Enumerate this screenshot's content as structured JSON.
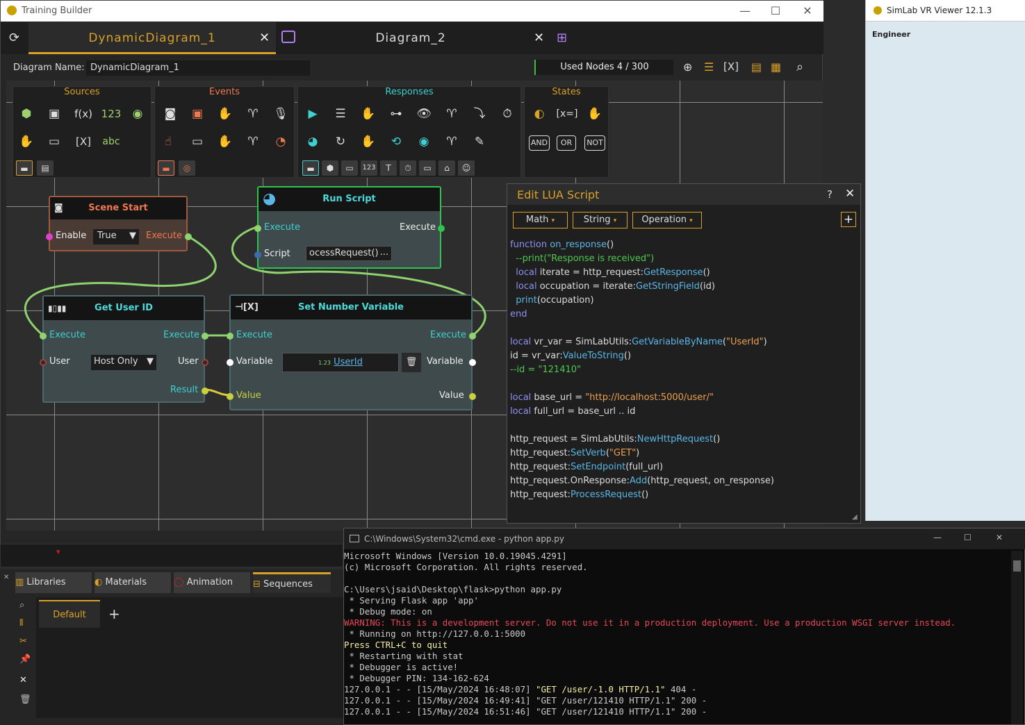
{
  "training_builder": {
    "title": "Training Builder",
    "tabs": [
      {
        "label": "DynamicDiagram_1"
      },
      {
        "label": "Diagram_2"
      }
    ],
    "diagram_name_label": "Diagram Name:",
    "diagram_name": "DynamicDiagram_1",
    "used_nodes": "Used Nodes 4 / 300"
  },
  "palette": {
    "sources": "Sources",
    "events": "Events",
    "responses": "Responses",
    "states": "States",
    "source_items": [
      "f(x)",
      "123",
      "[X]",
      "abc"
    ],
    "state_items": [
      "[x=]",
      "AND",
      "OR",
      "NOT"
    ],
    "response_items": [
      "123",
      "T"
    ]
  },
  "nodes": {
    "scene_start": {
      "title": "Scene Start",
      "enable": "Enable",
      "enable_value": "True",
      "execute": "Execute"
    },
    "run_script": {
      "title": "Run Script",
      "execute_in": "Execute",
      "execute_out": "Execute",
      "script": "Script",
      "script_value": "ocessRequest()",
      "more": "..."
    },
    "get_user_id": {
      "title": "Get User ID",
      "execute_in": "Execute",
      "execute_out": "Execute",
      "user_in": "User",
      "user_value": "Host Only",
      "user_out": "User",
      "result": "Result"
    },
    "set_number_variable": {
      "title": "Set Number Variable",
      "execute_in": "Execute",
      "execute_out": "Execute",
      "variable_in": "Variable",
      "variable_value": "UserId",
      "variable_out": "Variable",
      "value_in": "Value",
      "value_out": "Value"
    }
  },
  "lua": {
    "title": "Edit LUA Script",
    "help": "?",
    "dropdowns": [
      "Math",
      "String",
      "Operation"
    ],
    "lines": [
      [
        [
          "kw",
          "function "
        ],
        [
          "fn",
          "on_response"
        ],
        [
          "",
          "()"
        ]
      ],
      [
        [
          "cm",
          "  --print(\"Response is received\")"
        ]
      ],
      [
        [
          "",
          "  "
        ],
        [
          "kw",
          "local"
        ],
        [
          "",
          " iterate = http_request:"
        ],
        [
          "fn",
          "GetResponse"
        ],
        [
          "",
          "()"
        ]
      ],
      [
        [
          "",
          "  "
        ],
        [
          "kw",
          "local"
        ],
        [
          "",
          " occupation = iterate:"
        ],
        [
          "fn",
          "GetStringField"
        ],
        [
          "",
          "(id)"
        ]
      ],
      [
        [
          "",
          "  "
        ],
        [
          "fn",
          "print"
        ],
        [
          "",
          "(occupation)"
        ]
      ],
      [
        [
          "kw",
          "end"
        ]
      ],
      [
        [
          "",
          ""
        ]
      ],
      [
        [
          "kw",
          "local"
        ],
        [
          "",
          " vr_var = SimLabUtils:"
        ],
        [
          "fn",
          "GetVariableByName"
        ],
        [
          "",
          "("
        ],
        [
          "st",
          "\"UserId\""
        ],
        [
          "",
          ")"
        ]
      ],
      [
        [
          "",
          "id = vr_var:"
        ],
        [
          "fn",
          "ValueToString"
        ],
        [
          "",
          "()"
        ]
      ],
      [
        [
          "cm",
          "--id = \"121410\""
        ]
      ],
      [
        [
          "",
          ""
        ]
      ],
      [
        [
          "kw",
          "local"
        ],
        [
          "",
          " base_url = "
        ],
        [
          "st",
          "\"http://localhost:5000/user/\""
        ]
      ],
      [
        [
          "kw",
          "local"
        ],
        [
          "",
          " full_url = base_url .. id"
        ]
      ],
      [
        [
          "",
          ""
        ]
      ],
      [
        [
          "",
          "http_request = SimLabUtils:"
        ],
        [
          "fn",
          "NewHttpRequest"
        ],
        [
          "",
          "()"
        ]
      ],
      [
        [
          "",
          "http_request:"
        ],
        [
          "fn",
          "SetVerb"
        ],
        [
          "",
          "("
        ],
        [
          "st",
          "\"GET\""
        ],
        [
          "",
          ")"
        ]
      ],
      [
        [
          "",
          "http_request:"
        ],
        [
          "fn",
          "SetEndpoint"
        ],
        [
          "",
          "(full_url)"
        ]
      ],
      [
        [
          "",
          "http_request.OnResponse:"
        ],
        [
          "fn",
          "Add"
        ],
        [
          "",
          "(http_request, on_response)"
        ]
      ],
      [
        [
          "",
          "http_request:"
        ],
        [
          "fn",
          "ProcessRequest"
        ],
        [
          "",
          "()"
        ]
      ]
    ]
  },
  "vr_viewer": {
    "title": "SimLab VR Viewer 12.1.3",
    "role": "Engineer"
  },
  "cmd": {
    "title": "C:\\Windows\\System32\\cmd.exe - python  app.py",
    "lines": [
      {
        "t": "Microsoft Windows [Version 10.0.19045.4291]",
        "c": "#cccccc"
      },
      {
        "t": "(c) Microsoft Corporation. All rights reserved.",
        "c": "#cccccc"
      },
      {
        "t": "",
        "c": "#cccccc"
      },
      {
        "t": "C:\\Users\\jsaid\\Desktop\\flask>python app.py",
        "c": "#cccccc"
      },
      {
        "t": " * Serving Flask app 'app'",
        "c": "#cccccc"
      },
      {
        "t": " * Debug mode: on",
        "c": "#cccccc"
      },
      {
        "t": "WARNING: This is a development server. Do not use it in a production deployment. Use a production WSGI server instead.",
        "c": "#e74856"
      },
      {
        "t": " * Running on http://127.0.0.1:5000",
        "c": "#cccccc"
      },
      {
        "t": "Press CTRL+C to quit",
        "c": "#f9f1a5"
      },
      {
        "t": " * Restarting with stat",
        "c": "#cccccc"
      },
      {
        "t": " * Debugger is active!",
        "c": "#cccccc"
      },
      {
        "t": " * Debugger PIN: 134-162-624",
        "c": "#cccccc"
      },
      {
        "t": "127.0.0.1 - - [15/May/2024 16:48:07] \"GET /user/-1.0 HTTP/1.1\" 404 -",
        "c": "#cccccc",
        "hl": "\"GET /user/-1.0 HTTP/1.1\""
      },
      {
        "t": "127.0.0.1 - - [15/May/2024 16:49:41] \"GET /user/121410 HTTP/1.1\" 200 -",
        "c": "#cccccc"
      },
      {
        "t": "127.0.0.1 - - [15/May/2024 16:51:46] \"GET /user/121410 HTTP/1.1\" 200 -",
        "c": "#cccccc"
      }
    ]
  },
  "bottom": {
    "tabs": [
      "Libraries",
      "Materials",
      "Animation",
      "Sequences"
    ],
    "sequence": "Default",
    "add": "+"
  }
}
